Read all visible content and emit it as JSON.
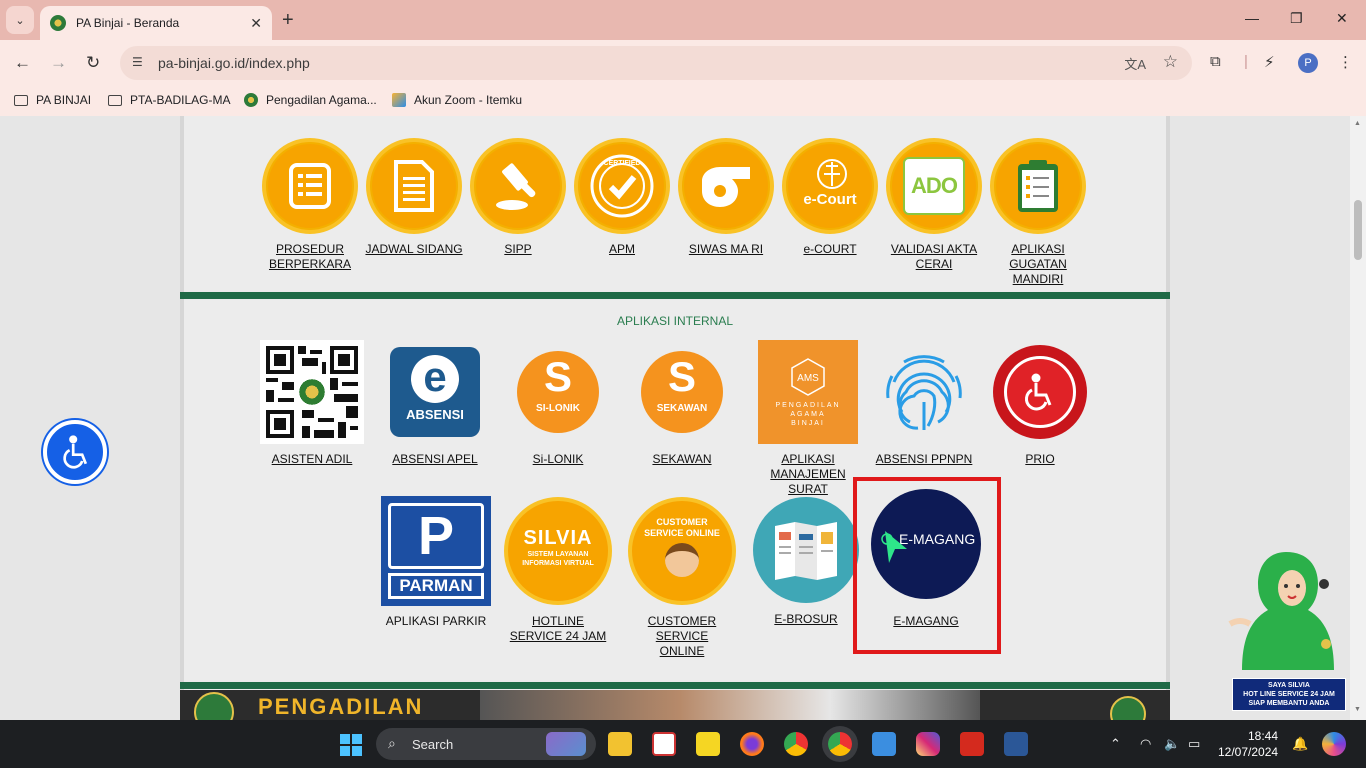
{
  "browser": {
    "tab_title": "PA Binjai - Beranda",
    "url": "pa-binjai.go.id/index.php",
    "profile_initial": "P",
    "bookmarks": [
      {
        "label": "PA BINJAI",
        "type": "folder"
      },
      {
        "label": "PTA-BADILAG-MA",
        "type": "folder"
      },
      {
        "label": "Pengadilan Agama...",
        "type": "site"
      },
      {
        "label": "Akun Zoom - Itemku",
        "type": "site"
      }
    ]
  },
  "page": {
    "external_apps": [
      {
        "label": "PROSEDUR\nBERPERKARA",
        "icon": "list-icon"
      },
      {
        "label": "JADWAL SIDANG",
        "icon": "document-icon"
      },
      {
        "label": "SIPP",
        "icon": "gavel-icon"
      },
      {
        "label": "APM",
        "icon": "certified-icon"
      },
      {
        "label": "SIWAS MA RI",
        "icon": "whistle-icon"
      },
      {
        "label": "e-COURT",
        "icon": "ecourt-icon"
      },
      {
        "label": "VALIDASI AKTA\nCERAI",
        "icon": "ado-icon"
      },
      {
        "label": "APLIKASI\nGUGATAN\nMANDIRI",
        "icon": "clipboard-icon"
      }
    ],
    "ecourt_text": "e-Court",
    "certified_text": "CERTIFIED",
    "ado_text": "ADO",
    "internal_title": "APLIKASI INTERNAL",
    "internal_row1": [
      {
        "label": "ASISTEN ADIL",
        "icon": "qr-code-icon"
      },
      {
        "label": "ABSENSI APEL",
        "icon": "absensi-icon",
        "badge": "ABSENSI"
      },
      {
        "label": " Si-LONIK",
        "icon": "silonik-icon",
        "badge": "SI-LONIK"
      },
      {
        "label": "SEKAWAN",
        "icon": "sekawan-icon",
        "badge": "SEKAWAN"
      },
      {
        "label": "APLIKASI\nMANAJEMEN SURAT",
        "icon": "ams-icon",
        "badge": "AMS",
        "sub": "PENGADILAN\nAGAMA\nBINJAI"
      },
      {
        "label": "ABSENSI PPNPN",
        "icon": "fingerprint-icon"
      },
      {
        "label": "PRIO",
        "icon": "wheelchair-icon"
      }
    ],
    "internal_row2": [
      {
        "label": "APLIKASI PARKIR",
        "icon": "parking-icon",
        "badge": "PARMAN"
      },
      {
        "label": "HOTLINE\nSERVICE 24 JAM",
        "icon": "silvia-icon",
        "badge": "SILVIA",
        "sub": "SISTEM LAYANAN\nINFORMASI VIRTUAL"
      },
      {
        "label": "CUSTOMER SERVICE\nONLINE ",
        "icon": "customer-service-icon",
        "badge": "CUSTOMER\nSERVICE ONLINE"
      },
      {
        "label": "E-BROSUR",
        "icon": "brochure-icon"
      },
      {
        "label": "E-MAGANG",
        "icon": "emagang-icon",
        "badge": "E-MAGANG"
      }
    ],
    "silvia_caption": "SAYA SILVIA\nHOT LINE SERVICE 24 JAM\nSIAP MEMBANTU ANDA",
    "banner_text": "PENGADILAN"
  },
  "taskbar": {
    "search_placeholder": "Search",
    "time": "18:44",
    "date": "12/07/2024"
  },
  "colors": {
    "orange": "#f7a400",
    "green_divider": "#1f6a46",
    "highlight": "#e0191a",
    "accessibility_blue": "#1560e6"
  }
}
